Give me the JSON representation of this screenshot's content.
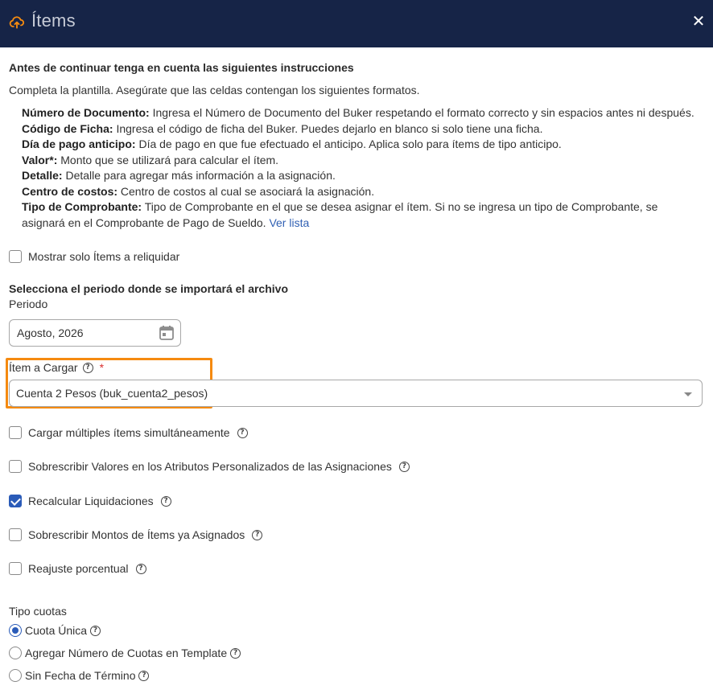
{
  "header": {
    "icon": "cloud-upload-icon",
    "title": "Ítems",
    "close_icon": "close-icon",
    "accent_color": "#f58a10",
    "bg_color": "#162447"
  },
  "instructions": {
    "title": "Antes de continuar tenga en cuenta las siguientes instrucciones",
    "subtitle": "Completa la plantilla. Asegúrate que las celdas contengan los siguientes formatos.",
    "rules": [
      {
        "label": "Número de Documento:",
        "text": " Ingresa el Número de Documento del Buker respetando el formato correcto y sin espacios antes ni después."
      },
      {
        "label": "Código de Ficha:",
        "text": " Ingresa el código de ficha del Buker. Puedes dejarlo en blanco si solo tiene una ficha."
      },
      {
        "label": "Día de pago anticipo:",
        "text": " Día de pago en que fue efectuado el anticipo. Aplica solo para ítems de tipo anticipo."
      },
      {
        "label": "Valor*:",
        "text": " Monto que se utilizará para calcular el ítem."
      },
      {
        "label": "Detalle:",
        "text": " Detalle para agregar más información a la asignación."
      },
      {
        "label": "Centro de costos:",
        "text": " Centro de costos al cual se asociará la asignación."
      },
      {
        "label": "Tipo de Comprobante:",
        "text": " Tipo de Comprobante en el que se desea asignar el ítem. Si no se ingresa un tipo de Comprobante, se asignará en el Comprobante de Pago de Sueldo. ",
        "link": "Ver lista"
      }
    ]
  },
  "options": {
    "show_reliquidar": {
      "label": "Mostrar solo Ítems a reliquidar",
      "checked": false
    }
  },
  "period": {
    "title": "Selecciona el periodo donde se importará el archivo",
    "label": "Periodo",
    "value": "Agosto, 2026",
    "icon": "calendar-icon"
  },
  "item": {
    "label": "Ítem a Cargar",
    "required_mark": "*",
    "value": "Cuenta 2 Pesos (buk_cuenta2_pesos)",
    "help_icon": "help-icon"
  },
  "checkboxes": [
    {
      "label": "Cargar múltiples ítems simultáneamente",
      "checked": false
    },
    {
      "label": "Sobrescribir Valores en los Atributos Personalizados de las Asignaciones",
      "checked": false
    },
    {
      "label": "Recalcular Liquidaciones",
      "checked": true
    },
    {
      "label": "Sobrescribir Montos de Ítems ya Asignados",
      "checked": false
    },
    {
      "label": "Reajuste porcentual",
      "checked": false
    }
  ],
  "tipo_cuotas": {
    "label": "Tipo cuotas",
    "options": [
      {
        "label": "Cuota Única",
        "checked": true
      },
      {
        "label": "Agregar Número de Cuotas en Template",
        "checked": false
      },
      {
        "label": "Sin Fecha de Término",
        "checked": false
      }
    ]
  }
}
